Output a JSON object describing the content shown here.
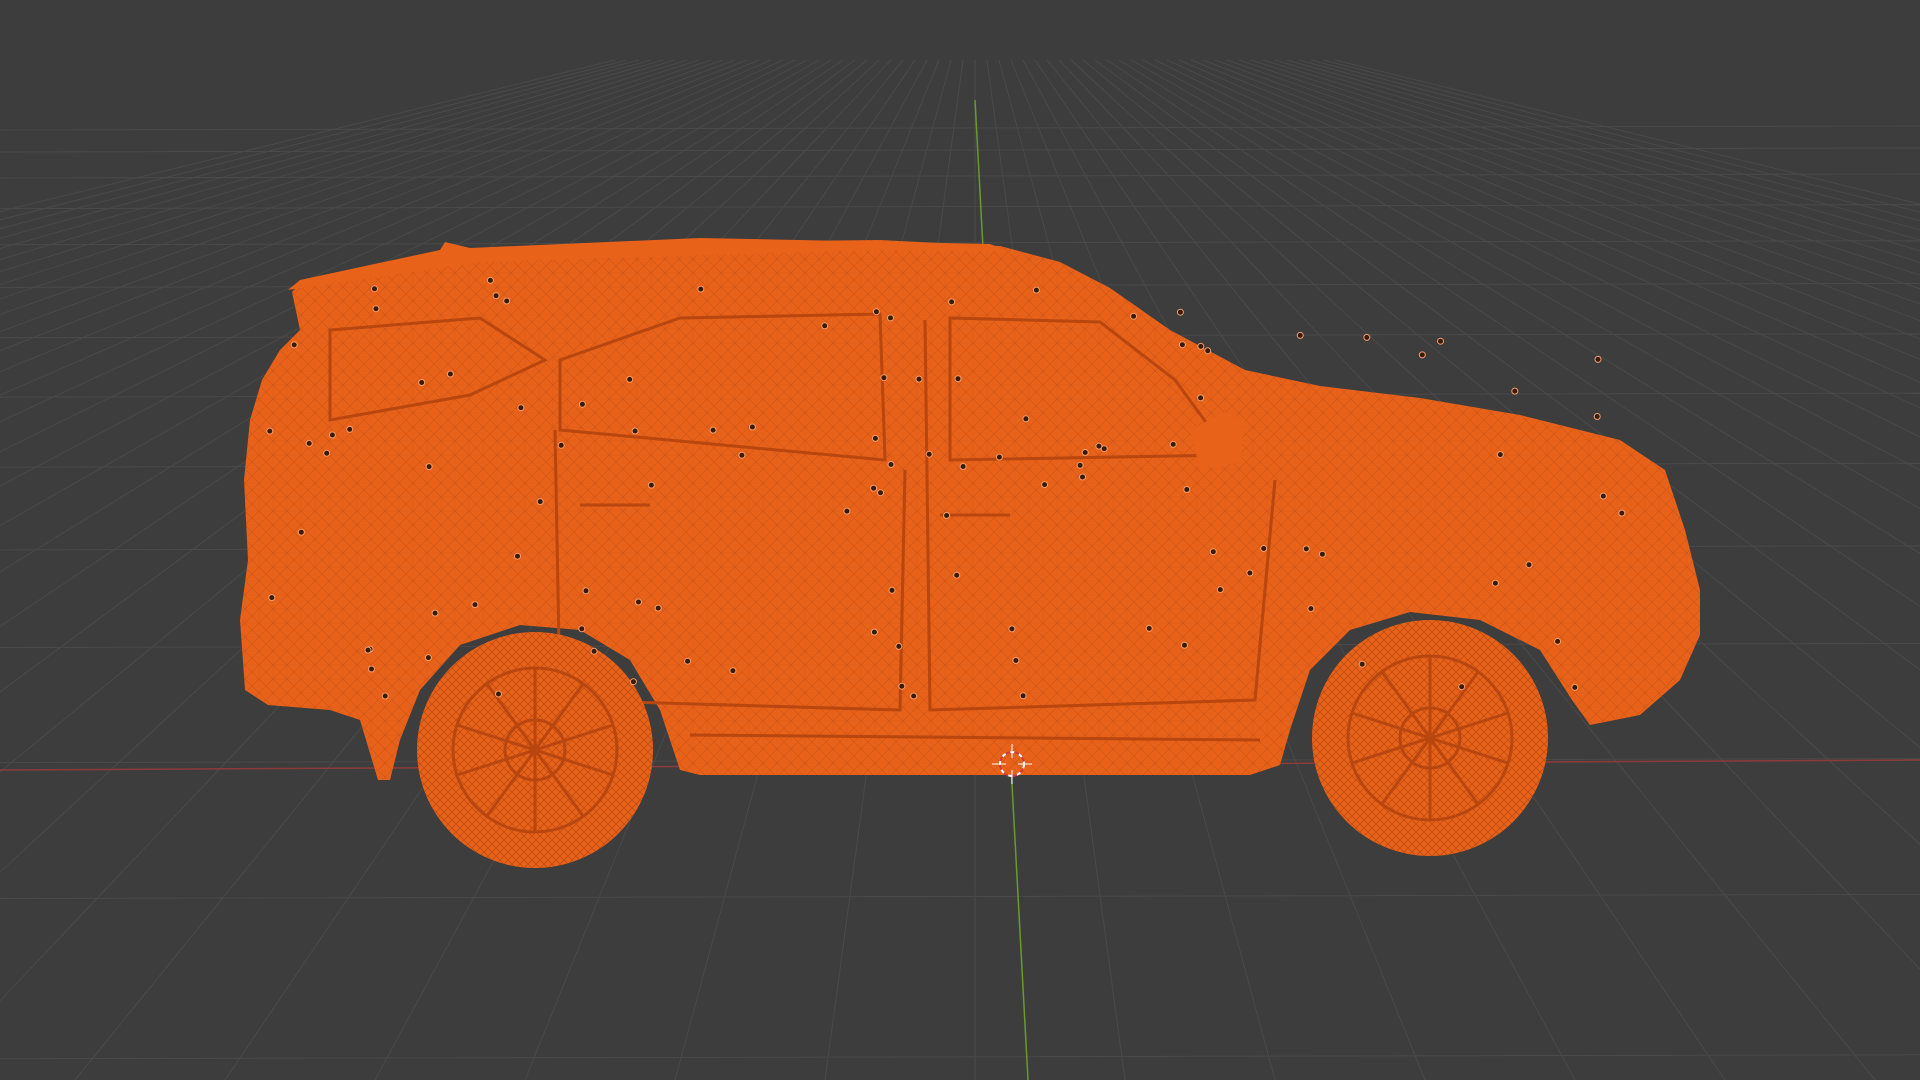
{
  "viewport": {
    "background_color": "#3d3d3d",
    "grid_color": "#4a4a4a",
    "axis_x_color": "#8c3b3b",
    "axis_y_color": "#6a9a2e",
    "selection_color": "#e8621a",
    "wire_color": "#b8460e"
  },
  "scene": {
    "object": "suv-wireframe-mesh",
    "object_state": "selected",
    "cursor_icon": "3d-cursor-icon",
    "view": "side-orthographic"
  }
}
